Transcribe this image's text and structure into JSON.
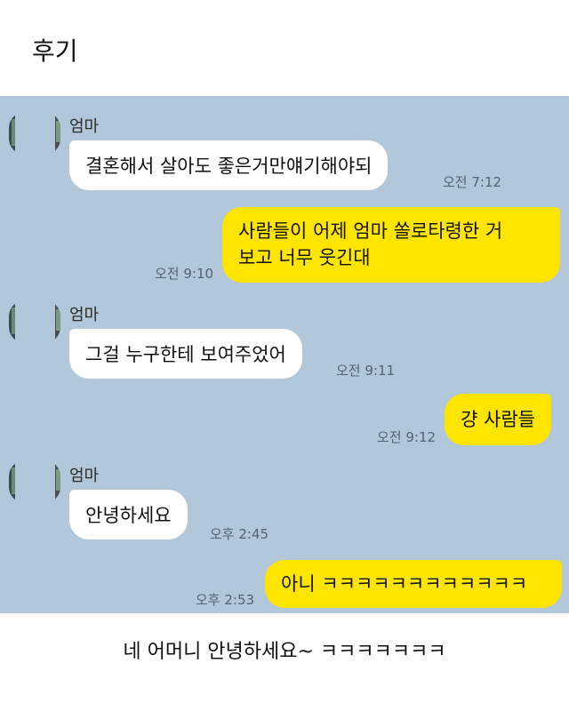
{
  "header": {
    "title": "후기"
  },
  "messages": [
    {
      "sender": "엄마",
      "text": "결혼해서 살아도  좋은거만얘기해야되",
      "time": "오전 7:12"
    },
    {
      "text_line1": "사람들이 어제 엄마 쏠로타령한 거",
      "text_line2": "보고 너무 웃긴대",
      "time": "오전 9:10"
    },
    {
      "sender": "엄마",
      "text": "그걸 누구한테 보여주었어",
      "time": "오전 9:11"
    },
    {
      "text": "걍 사람들",
      "time": "오전 9:12"
    },
    {
      "sender": "엄마",
      "text": "안녕하세요",
      "time": "오후 2:45"
    },
    {
      "text": "아니 ㅋㅋㅋㅋㅋㅋㅋㅋㅋㅋㅋㅋ",
      "time": "오후 2:53"
    }
  ],
  "caption": "네 어머니 안녕하세요~ ㅋㅋㅋㅋㅋㅋㅋ",
  "colors": {
    "chat_bg": "#b2c7d9",
    "outgoing_bubble": "#fee500",
    "incoming_bubble": "#ffffff"
  }
}
